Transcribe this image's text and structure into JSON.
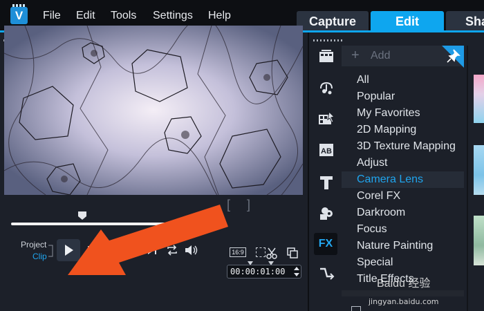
{
  "menu": {
    "items": [
      {
        "label": "File"
      },
      {
        "label": "Edit"
      },
      {
        "label": "Tools"
      },
      {
        "label": "Settings"
      },
      {
        "label": "Help"
      }
    ]
  },
  "workspace_tabs": [
    {
      "label": "Capture",
      "active": false
    },
    {
      "label": "Edit",
      "active": true
    },
    {
      "label": "Sha",
      "active": false
    }
  ],
  "player": {
    "project_label": "Project",
    "clip_label": "Clip",
    "aspect_label": "16:9",
    "timecode": "00:00:01:00",
    "scrub_position": 0.36
  },
  "library": {
    "add_label": "Add",
    "fx_label": "FX",
    "categories": [
      {
        "label": "All"
      },
      {
        "label": "Popular"
      },
      {
        "label": "My Favorites"
      },
      {
        "label": "2D Mapping"
      },
      {
        "label": "3D Texture Mapping"
      },
      {
        "label": "Adjust"
      },
      {
        "label": "Camera Lens",
        "selected": true
      },
      {
        "label": "Corel FX"
      },
      {
        "label": "Darkroom"
      },
      {
        "label": "Focus"
      },
      {
        "label": "Nature Painting"
      },
      {
        "label": "Special"
      },
      {
        "label": "Title Effects"
      }
    ],
    "rail_icons": [
      "media-icon",
      "audio-icon",
      "transition-icon",
      "graphics-icon",
      "title-icon",
      "overlay-icon",
      "fx-icon",
      "path-icon"
    ]
  },
  "watermark": {
    "text": "Baidu 经验",
    "url_text": "jingyan.baidu.com"
  },
  "colors": {
    "accent": "#0ea6ef",
    "selected_text": "#1fa5ee",
    "annotation_arrow": "#f0521e"
  }
}
